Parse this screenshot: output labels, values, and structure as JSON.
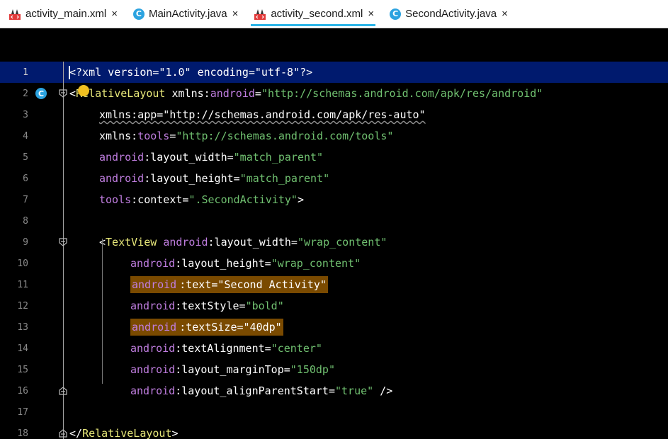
{
  "tabs": [
    {
      "label": "activity_main.xml",
      "icon": "xml-file-icon",
      "active": false
    },
    {
      "label": "MainActivity.java",
      "icon": "java-class-icon",
      "active": false
    },
    {
      "label": "activity_second.xml",
      "icon": "xml-file-icon",
      "active": true
    },
    {
      "label": "SecondActivity.java",
      "icon": "java-class-icon",
      "active": false
    }
  ],
  "close_glyph": "×",
  "java_icon_letter": "C",
  "colors": {
    "tab_active_underline": "#2bb5e8",
    "current_line": "#001a6e",
    "highlight": "#7a4a00",
    "string": "#70c070",
    "attr": "#c07ee0",
    "tag": "#e8e87a"
  },
  "lines": [
    {
      "n": "1",
      "tokens": [
        [
          "t-xmlkw",
          "<?xml version=\"1.0\" encoding=\"utf-8\"?>"
        ]
      ]
    },
    {
      "n": "2",
      "tokens": [
        [
          "t-plain",
          "<"
        ],
        [
          "t-tag",
          "RelativeLayout"
        ],
        [
          "t-plain",
          " "
        ],
        [
          "t-ns",
          "xmlns:"
        ],
        [
          "t-attr",
          "android"
        ],
        [
          "t-plain",
          "="
        ],
        [
          "t-str",
          "\"http://schemas.android.com/apk/res/android\""
        ]
      ]
    },
    {
      "n": "3",
      "tokens": [
        [
          "t-ns squiggle",
          "xmlns:app=\"http://schemas.android.com/apk/res-auto\""
        ]
      ]
    },
    {
      "n": "4",
      "tokens": [
        [
          "t-ns",
          "xmlns:"
        ],
        [
          "t-attr",
          "tools"
        ],
        [
          "t-plain",
          "="
        ],
        [
          "t-str",
          "\"http://schemas.android.com/tools\""
        ]
      ]
    },
    {
      "n": "5",
      "tokens": [
        [
          "t-attr",
          "android"
        ],
        [
          "t-plain",
          ":layout_width="
        ],
        [
          "t-str",
          "\"match_parent\""
        ]
      ]
    },
    {
      "n": "6",
      "tokens": [
        [
          "t-attr",
          "android"
        ],
        [
          "t-plain",
          ":layout_height="
        ],
        [
          "t-str",
          "\"match_parent\""
        ]
      ]
    },
    {
      "n": "7",
      "tokens": [
        [
          "t-attr",
          "tools"
        ],
        [
          "t-plain",
          ":context="
        ],
        [
          "t-str",
          "\".SecondActivity\""
        ],
        [
          "t-plain",
          ">"
        ]
      ]
    },
    {
      "n": "8",
      "tokens": []
    },
    {
      "n": "9",
      "tokens": [
        [
          "t-plain",
          "<"
        ],
        [
          "t-tag",
          "TextView"
        ],
        [
          "t-plain",
          " "
        ],
        [
          "t-attr",
          "android"
        ],
        [
          "t-plain",
          ":layout_width="
        ],
        [
          "t-str",
          "\"wrap_content\""
        ]
      ]
    },
    {
      "n": "10",
      "tokens": [
        [
          "t-attr",
          "android"
        ],
        [
          "t-plain",
          ":layout_height="
        ],
        [
          "t-str",
          "\"wrap_content\""
        ]
      ]
    },
    {
      "n": "11",
      "tokens": [
        [
          "t-attr hl",
          "android"
        ],
        [
          "t-plain hl",
          ":text=\"Second Activity\""
        ]
      ]
    },
    {
      "n": "12",
      "tokens": [
        [
          "t-attr",
          "android"
        ],
        [
          "t-plain",
          ":textStyle="
        ],
        [
          "t-str",
          "\"bold\""
        ]
      ]
    },
    {
      "n": "13",
      "tokens": [
        [
          "t-attr hl",
          "android"
        ],
        [
          "t-plain hl",
          ":textSize=\"40dp\""
        ]
      ]
    },
    {
      "n": "14",
      "tokens": [
        [
          "t-attr",
          "android"
        ],
        [
          "t-plain",
          ":textAlignment="
        ],
        [
          "t-str",
          "\"center\""
        ]
      ]
    },
    {
      "n": "15",
      "tokens": [
        [
          "t-attr",
          "android"
        ],
        [
          "t-plain",
          ":layout_marginTop="
        ],
        [
          "t-str",
          "\"150dp\""
        ]
      ]
    },
    {
      "n": "16",
      "tokens": [
        [
          "t-attr",
          "android"
        ],
        [
          "t-plain",
          ":layout_alignParentStart="
        ],
        [
          "t-str",
          "\"true\""
        ],
        [
          "t-plain",
          " />"
        ]
      ]
    },
    {
      "n": "17",
      "tokens": []
    },
    {
      "n": "18",
      "tokens": [
        [
          "t-plain",
          "</"
        ],
        [
          "t-tag",
          "RelativeLayout"
        ],
        [
          "t-plain",
          ">"
        ]
      ]
    }
  ]
}
